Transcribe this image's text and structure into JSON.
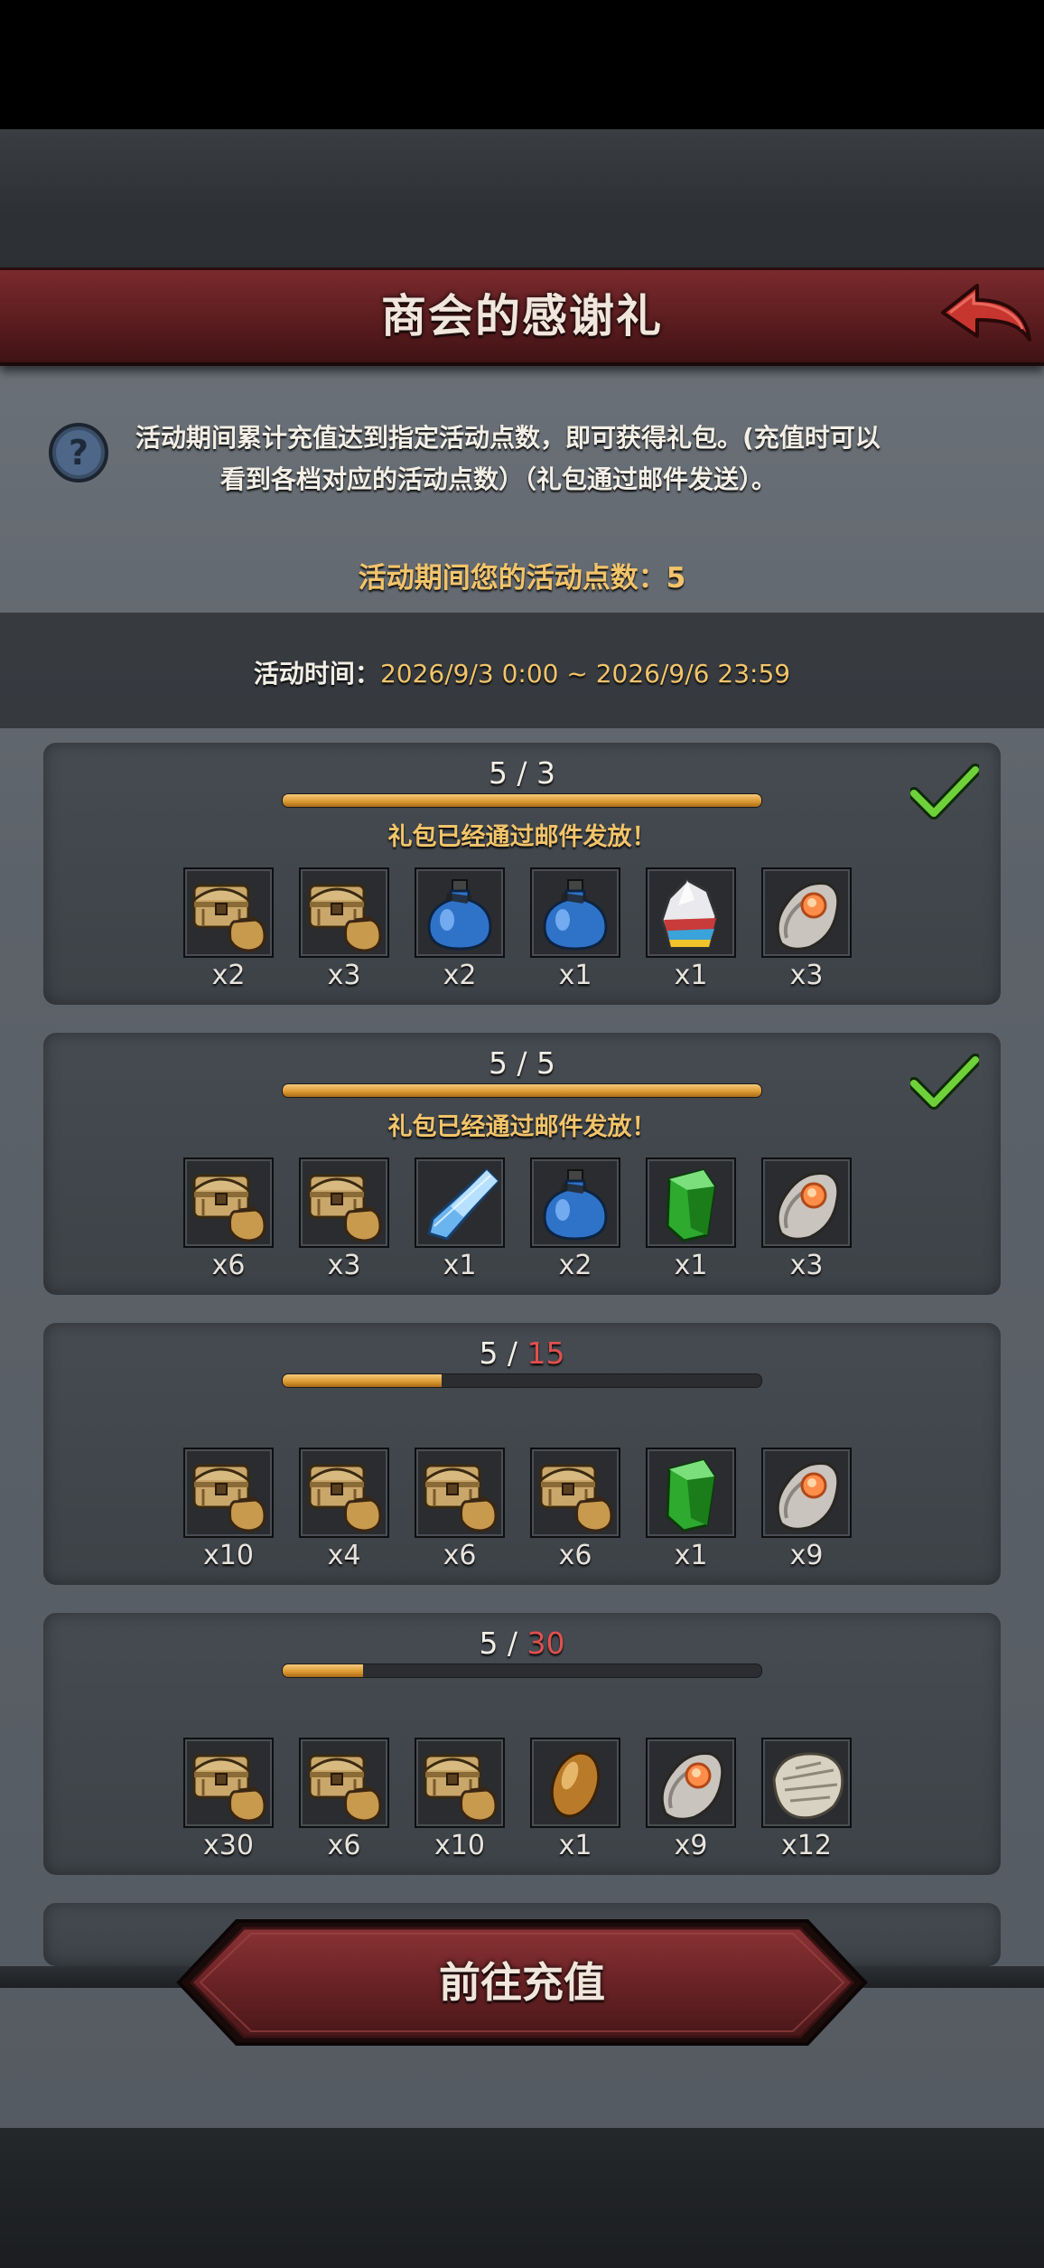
{
  "header": {
    "title": "商会的感谢礼"
  },
  "info": {
    "line1": "活动期间累计充值达到指定活动点数，即可获得礼包。(充值时可以",
    "line2": "看到各档对应的活动点数）（礼包通过邮件发送）。"
  },
  "points": {
    "label": "活动期间您的活动点数：",
    "value": "5"
  },
  "time": {
    "label": "活动时间：",
    "value": "2026/9/3 0:00 ~ 2026/9/6 23:59"
  },
  "tiers": [
    {
      "current": "5",
      "sep": " / ",
      "need": "3",
      "progress": 1.0,
      "claimed": true,
      "claimed_text": "礼包已经通过邮件发放！",
      "items": [
        {
          "icon": "chest-bag-icon",
          "qty": "x2"
        },
        {
          "icon": "chest-bag-icon",
          "qty": "x3"
        },
        {
          "icon": "potion-icon",
          "qty": "x2"
        },
        {
          "icon": "potion-icon",
          "qty": "x1"
        },
        {
          "icon": "rainbow-crystal-icon",
          "qty": "x1"
        },
        {
          "icon": "ore-stone-icon",
          "qty": "x3"
        }
      ]
    },
    {
      "current": "5",
      "sep": " / ",
      "need": "5",
      "progress": 1.0,
      "claimed": true,
      "claimed_text": "礼包已经通过邮件发放！",
      "items": [
        {
          "icon": "chest-bag-icon",
          "qty": "x6"
        },
        {
          "icon": "chest-bag-icon",
          "qty": "x3"
        },
        {
          "icon": "blue-crystal-icon",
          "qty": "x1"
        },
        {
          "icon": "potion-icon",
          "qty": "x2"
        },
        {
          "icon": "green-gem-icon",
          "qty": "x1"
        },
        {
          "icon": "ore-stone-icon",
          "qty": "x3"
        }
      ]
    },
    {
      "current": "5",
      "sep": " / ",
      "need": "15",
      "progress": 0.333,
      "claimed": false,
      "claimed_text": "",
      "items": [
        {
          "icon": "chest-bag-icon",
          "qty": "x10"
        },
        {
          "icon": "chest-bag-icon",
          "qty": "x4"
        },
        {
          "icon": "chest-bag-icon",
          "qty": "x6"
        },
        {
          "icon": "chest-bag-icon",
          "qty": "x6"
        },
        {
          "icon": "green-gem-icon",
          "qty": "x1"
        },
        {
          "icon": "ore-stone-icon",
          "qty": "x9"
        }
      ]
    },
    {
      "current": "5",
      "sep": " / ",
      "need": "30",
      "progress": 0.167,
      "claimed": false,
      "claimed_text": "",
      "items": [
        {
          "icon": "chest-bag-icon",
          "qty": "x30"
        },
        {
          "icon": "chest-bag-icon",
          "qty": "x6"
        },
        {
          "icon": "chest-bag-icon",
          "qty": "x10"
        },
        {
          "icon": "amber-seed-icon",
          "qty": "x1"
        },
        {
          "icon": "ore-stone-icon",
          "qty": "x9"
        },
        {
          "icon": "fur-pelt-icon",
          "qty": "x12"
        }
      ]
    }
  ],
  "footer": {
    "recharge_label": "前往充值"
  },
  "colors": {
    "banner": "#5c1d20",
    "accent_gold": "#f2c46a",
    "need_red": "#e05050",
    "check_green": "#6fd13a"
  }
}
